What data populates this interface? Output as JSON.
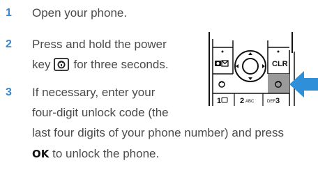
{
  "steps": [
    {
      "number": "1",
      "lines": [
        "Open your phone."
      ]
    },
    {
      "number": "2",
      "lines": [
        "Press and hold the power",
        "key",
        "for three seconds."
      ]
    },
    {
      "number": "3",
      "lines": [
        "If necessary, enter your",
        "four-digit unlock code (the",
        "last four digits of your phone number) and press",
        "OK",
        "to unlock the phone."
      ]
    }
  ],
  "icons": {
    "power_key": "power-key-icon",
    "callout_arrow": "arrow-icon"
  },
  "phone_keypad": {
    "clr_label": "CLR",
    "key_1": "1",
    "key_2": "2",
    "key_2_letters": "ABC",
    "key_3": "3",
    "key_3_letters": "DEF"
  },
  "colors": {
    "step_number": "#3a86c8",
    "callout_arrow": "#2f8fd8",
    "highlight_key": "#9a9a9a"
  }
}
